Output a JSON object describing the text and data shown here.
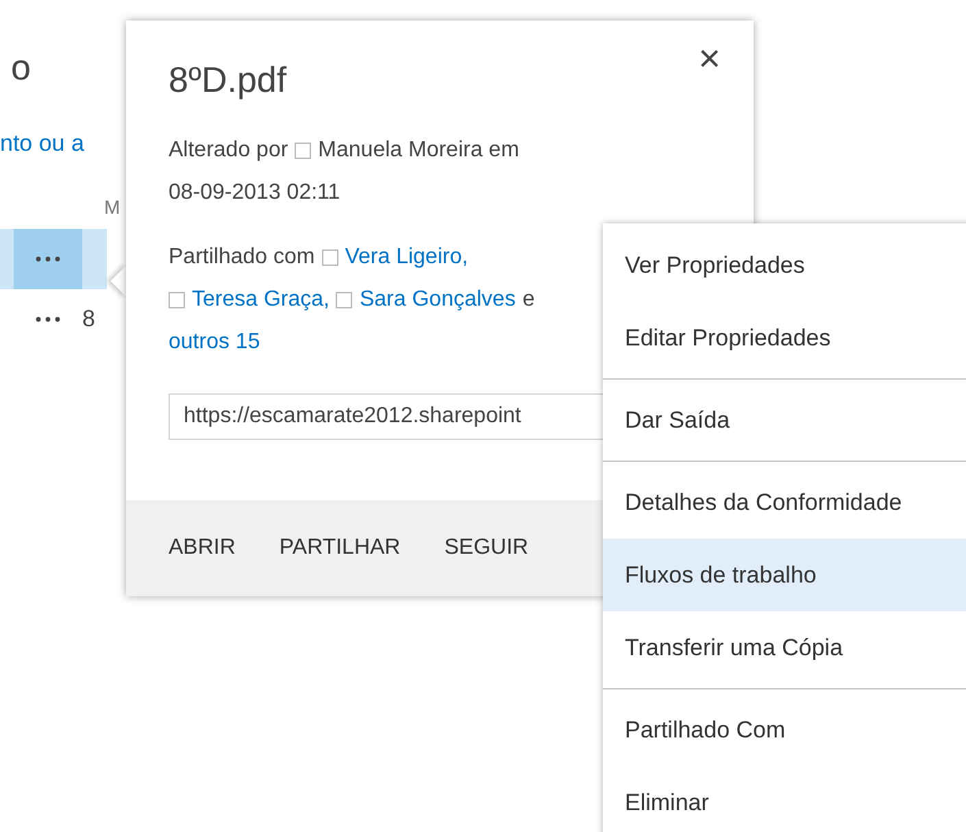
{
  "page": {
    "title": "o",
    "link": "nto ou a",
    "column_header": "M",
    "rows": [
      {
        "selected": true,
        "name": ""
      },
      {
        "selected": false,
        "name": "8"
      }
    ]
  },
  "callout": {
    "title": "8ºD.pdf",
    "close": "×",
    "modified": {
      "label": "Alterado por",
      "person": "Manuela Moreira em",
      "date": "08-09-2013 02:11"
    },
    "shared": {
      "label": "Partilhado com",
      "people": [
        "Vera Ligeiro,",
        "Teresa Graça,",
        "Sara Gonçalves"
      ],
      "and": "e",
      "others": "outros 15"
    },
    "url": "https://escamarate2012.sharepoint",
    "actions": [
      "ABRIR",
      "PARTILHAR",
      "SEGUIR"
    ]
  },
  "menu": {
    "groups": [
      [
        {
          "label": "Ver Propriedades",
          "selected": false
        },
        {
          "label": "Editar Propriedades",
          "selected": false
        }
      ],
      [
        {
          "label": "Dar Saída",
          "selected": false
        }
      ],
      [
        {
          "label": "Detalhes da Conformidade",
          "selected": false
        },
        {
          "label": "Fluxos de trabalho",
          "selected": true
        },
        {
          "label": "Transferir uma Cópia",
          "selected": false
        }
      ],
      [
        {
          "label": "Partilhado Com",
          "selected": false
        },
        {
          "label": "Eliminar",
          "selected": false
        }
      ]
    ]
  }
}
